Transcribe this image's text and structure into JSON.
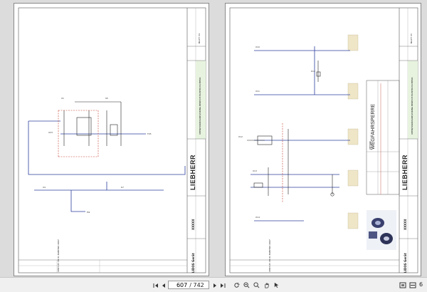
{
  "viewer": {
    "current_page": "607",
    "total_pages": "/ 742",
    "zoom_partial": "6"
  },
  "left_sheet": {
    "brand": "LIEBHERR",
    "project": "LIDOS Gerät",
    "code": "XXXXX",
    "band_text": "OPEN/HARDWARE/WIRING BEREICH ELEKTROSCHEMA",
    "sheet_no": "BLATT 34",
    "bottom_text": "CH07-05 CB 01 ELEKTRO 2007"
  },
  "right_sheet": {
    "brand": "LIEBHERR",
    "project": "LIDOS Gerät",
    "code": "XXXXX",
    "title_small": "OPTION",
    "title_main": "WEGFAHRSPERRE",
    "band_text": "OPEN/HARDWARE/WIRING BEREICH ELEKTROSCHEMA",
    "sheet_no": "BLATT 35",
    "bottom_text": "CH07-05 CB 01 ELEKTRO 2007"
  },
  "colors": {
    "wire_blue": "#2b3f9e",
    "dash_red": "#c0392b",
    "band_green": "#e7f3df"
  },
  "icons": [
    "save-icon",
    "print-icon",
    "up-icon",
    "down-icon",
    "first-icon",
    "prev-icon",
    "next-icon",
    "last-icon",
    "select-icon",
    "hand-icon",
    "zoomout-icon",
    "zoomin-icon",
    "fit-icon",
    "rotate-icon"
  ]
}
